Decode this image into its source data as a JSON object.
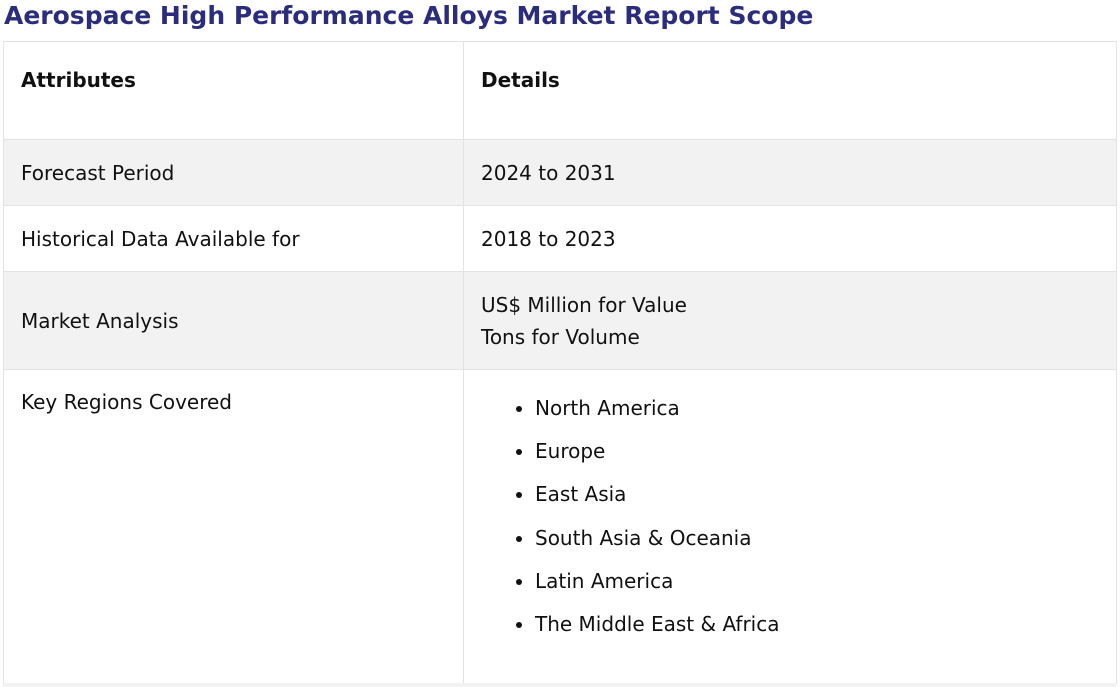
{
  "title": "Aerospace High Performance Alloys Market Report Scope",
  "table": {
    "headers": {
      "attribute": "Attributes",
      "details": "Details"
    },
    "rows": [
      {
        "attribute": "Forecast Period",
        "details": [
          "2024 to 2031"
        ]
      },
      {
        "attribute": "Historical Data Available for",
        "details": [
          "2018 to 2023"
        ]
      },
      {
        "attribute": "Market Analysis",
        "details": [
          "US$ Million for Value",
          "Tons for Volume"
        ]
      },
      {
        "attribute": "Key Regions Covered",
        "details_list": [
          "North America",
          "Europe",
          "East Asia",
          "South Asia & Oceania",
          "Latin America",
          "The Middle East & Africa"
        ]
      }
    ]
  },
  "colors": {
    "title": "#2b2d7c",
    "shaded_row": "#f2f2f2",
    "border": "#e3e3e3"
  }
}
